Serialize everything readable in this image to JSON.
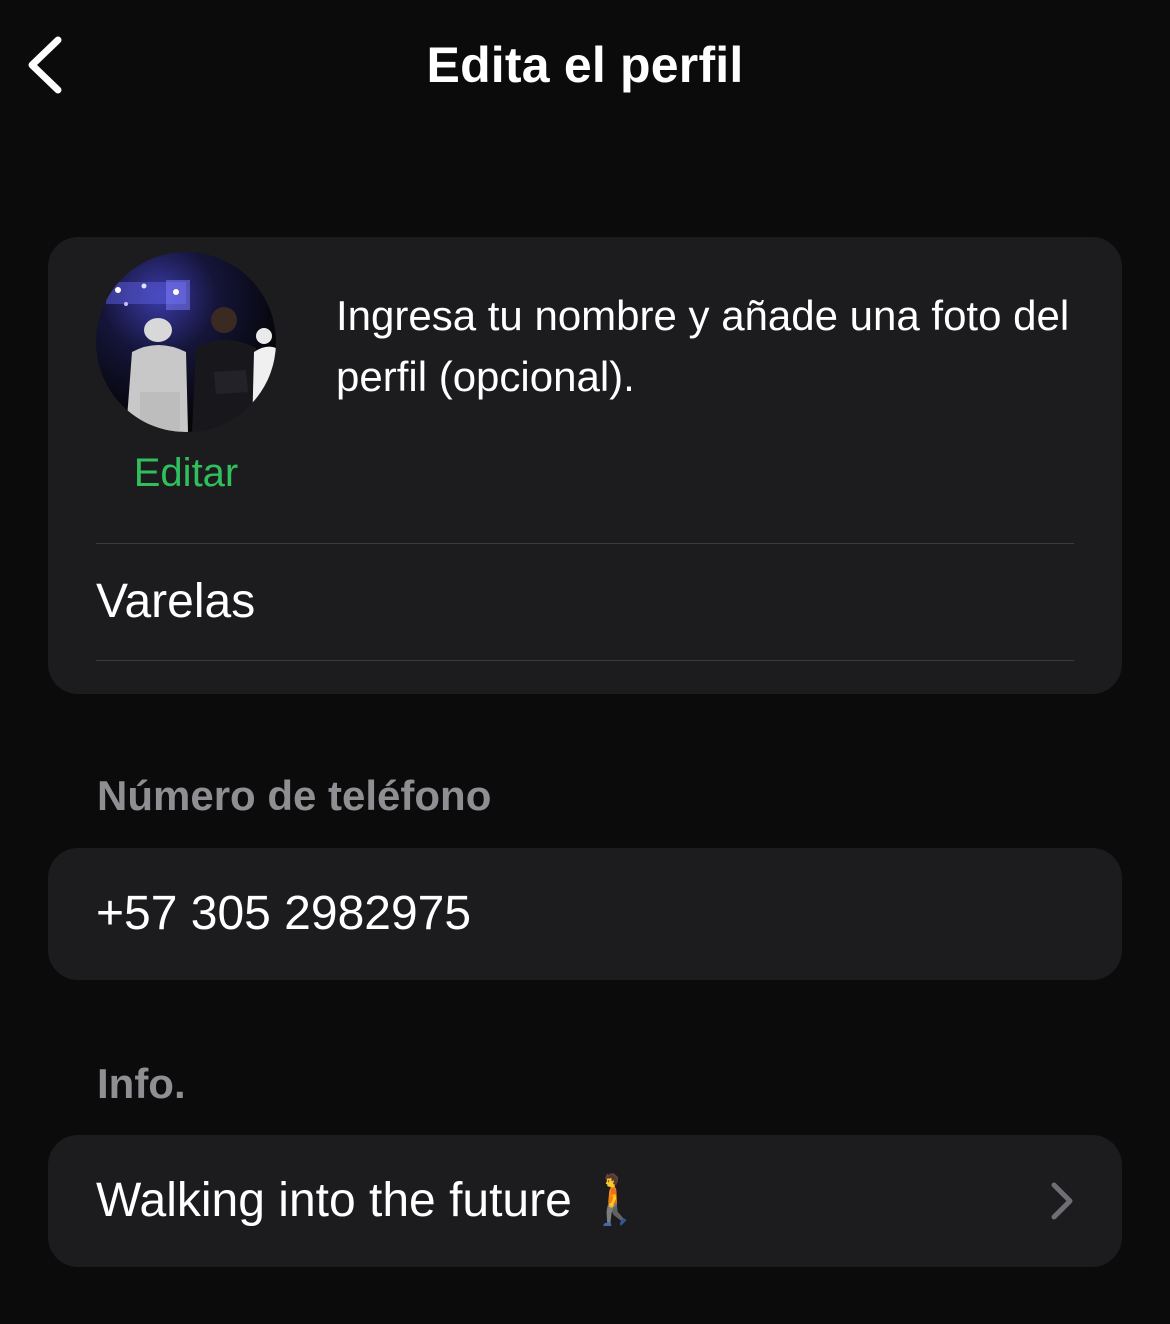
{
  "nav": {
    "title": "Edita el perfil",
    "back_icon": "chevron-left-icon"
  },
  "profile": {
    "avatar_icon": "profile-photo",
    "edit_label": "Editar",
    "hint": "Ingresa tu nombre y añade una foto del perfil (opcional).",
    "name_value": "Varelas"
  },
  "phone_section": {
    "label": "Número de teléfono",
    "value": "+57 305 2982975"
  },
  "info_section": {
    "label": "Info.",
    "value": "Walking into the future 🚶",
    "chevron_icon": "chevron-right-icon"
  },
  "colors": {
    "background": "#0b0b0b",
    "card": "#1c1c1e",
    "accent": "#2fbf5c",
    "secondary_text": "#8e8e93",
    "divider": "#3a3a3c"
  }
}
